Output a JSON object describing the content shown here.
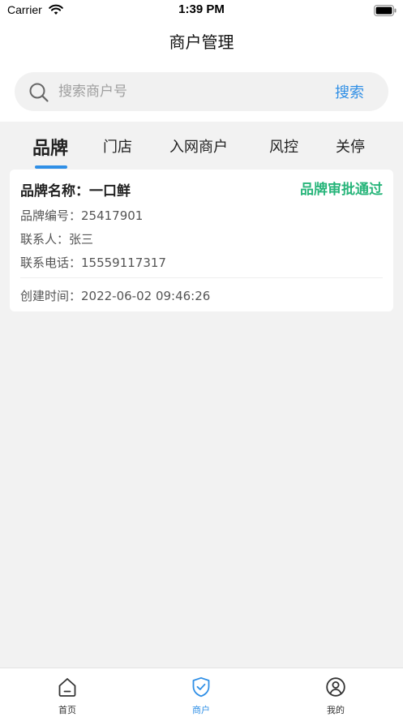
{
  "status_bar": {
    "carrier": "Carrier",
    "time": "1:39 PM"
  },
  "header": {
    "title": "商户管理"
  },
  "search": {
    "placeholder": "搜索商户号",
    "button_label": "搜索",
    "icon": "search-icon"
  },
  "tabs": [
    {
      "label": "品牌",
      "active": true
    },
    {
      "label": "门店",
      "active": false
    },
    {
      "label": "入网商户",
      "active": false
    },
    {
      "label": "风控",
      "active": false
    },
    {
      "label": "关停",
      "active": false
    }
  ],
  "card": {
    "brand_name": "品牌名称：一口鲜",
    "status": "品牌审批通过",
    "brand_code": "品牌编号：25417901",
    "contact": "联系人：张三",
    "phone": "联系电话：15559117317",
    "created_time": "创建时间：2022-06-02 09:46:26"
  },
  "bottom_nav": [
    {
      "label": "首页",
      "icon": "home-icon",
      "active": false
    },
    {
      "label": "商户",
      "icon": "shield-check-icon",
      "active": true
    },
    {
      "label": "我的",
      "icon": "user-icon",
      "active": false
    }
  ],
  "colors": {
    "accent": "#2f8fe6",
    "status_green": "#27b57a",
    "background": "#f2f2f2"
  }
}
